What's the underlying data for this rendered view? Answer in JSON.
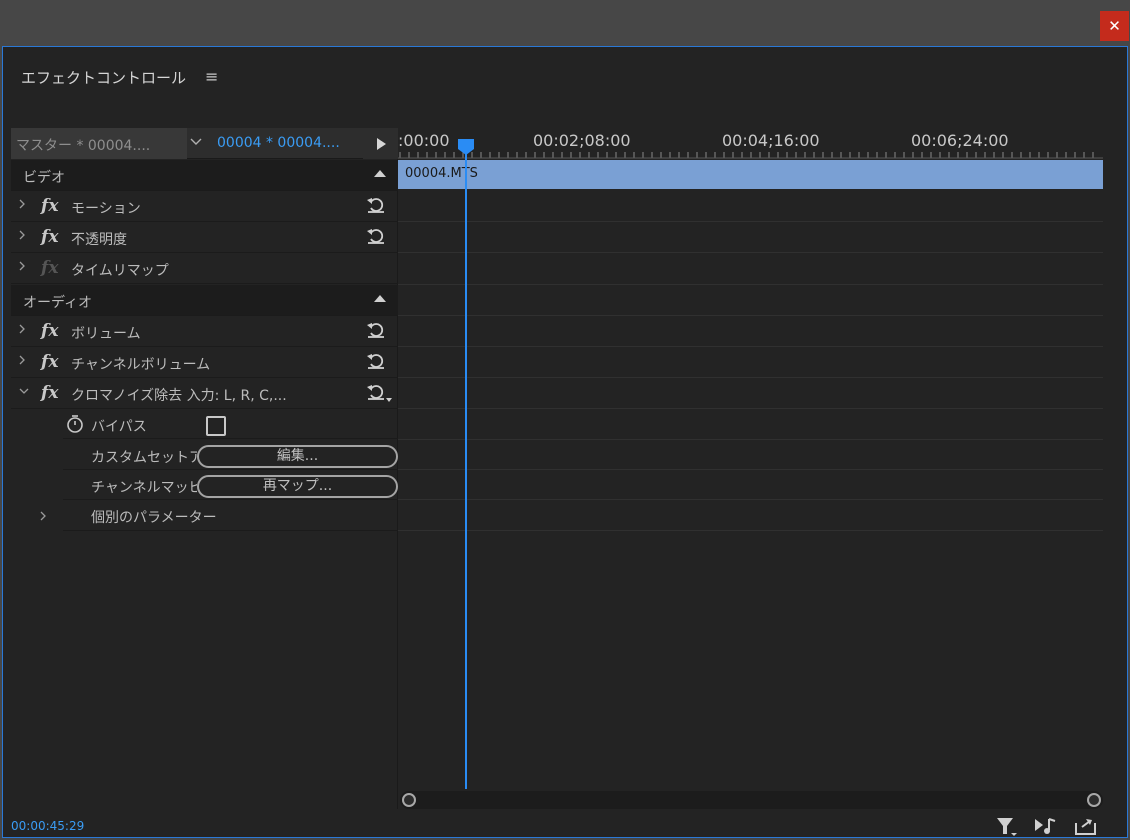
{
  "window": {
    "close_glyph": "✕"
  },
  "panel": {
    "title": "エフェクトコントロール",
    "menu_glyph": "≡"
  },
  "clip_tabs": {
    "master_label": "マスター * 00004....",
    "current_label": "00004 * 00004....",
    "chevron_glyph": "⌵",
    "play_glyph": "▶"
  },
  "sections": {
    "video": {
      "label": "ビデオ"
    },
    "audio": {
      "label": "オーディオ"
    }
  },
  "effects": {
    "motion": {
      "label": "モーション"
    },
    "opacity": {
      "label": "不透明度"
    },
    "time_remap": {
      "label": "タイムリマップ"
    },
    "volume": {
      "label": "ボリューム"
    },
    "channel_volume": {
      "label": "チャンネルボリューム"
    },
    "chroma_noise": {
      "label": "クロマノイズ除去  入力: L, R, C,..."
    }
  },
  "chroma_params": {
    "bypass_label": "バイパス",
    "bypass_checked": false,
    "custom_setup_label": "カスタムセットアップ",
    "custom_setup_button": "編集...",
    "channel_map_label": "チャンネルマッピング",
    "channel_map_button": "再マップ...",
    "individual_params_label": "個別のパラメーター"
  },
  "timeline": {
    "ruler_labels": [
      ":00:00",
      "00:02;08:00",
      "00:04;16:00",
      "00:06;24:00"
    ],
    "clip_name": "00004.MTS"
  },
  "footer": {
    "timecode": "00:00:45:29"
  },
  "colors": {
    "accent": "#2a8cf4",
    "clip_bar": "#7aa0d4",
    "close": "#c42b1c"
  },
  "icons": [
    "close-icon",
    "hamburger-menu-icon",
    "chevron-down-icon",
    "play-icon",
    "collapse-arrow-icon",
    "chevron-right-icon",
    "fx-icon",
    "reset-icon",
    "stopwatch-icon",
    "filter-icon",
    "audio-play-icon",
    "export-icon"
  ]
}
